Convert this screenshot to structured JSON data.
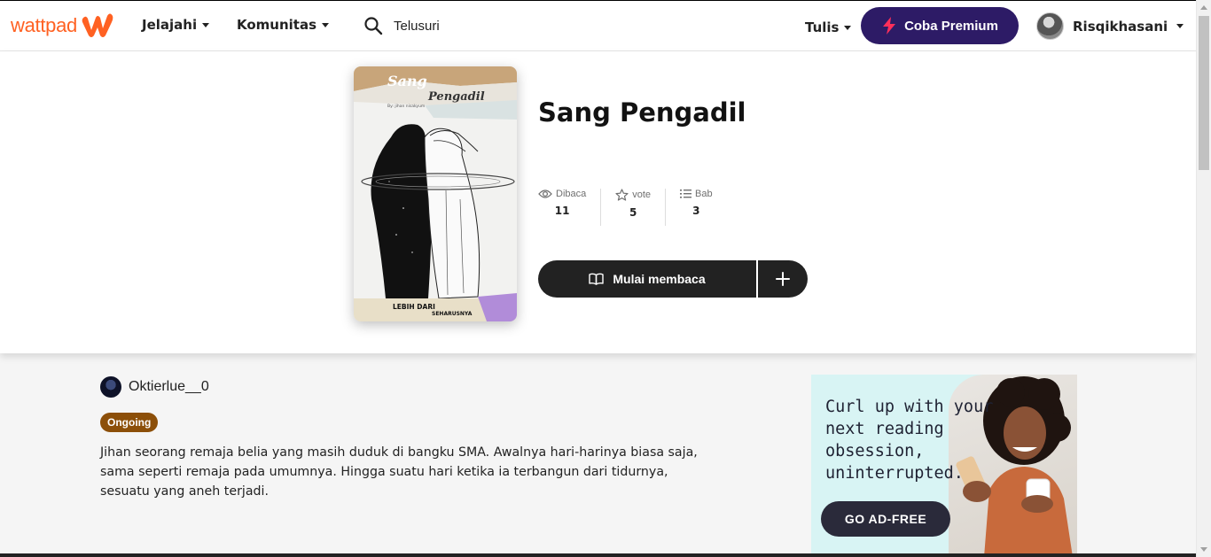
{
  "header": {
    "brand": "wattpad",
    "nav": [
      {
        "label": "Jelajahi"
      },
      {
        "label": "Komunitas"
      }
    ],
    "search_placeholder": "Telusuri",
    "write_label": "Tulis",
    "premium_label": "Coba Premium",
    "username": "Risqikhasani"
  },
  "story": {
    "title": "Sang Pengadil",
    "cover": {
      "title_line1": "Sang",
      "title_line2": "Pengadil",
      "byline": "By: jihan nisakyum",
      "bottom_line1": "LEBIH DARI",
      "bottom_line2": "SEHARUSNYA"
    },
    "stats": {
      "reads_label": "Dibaca",
      "reads_value": "11",
      "votes_label": "vote",
      "votes_value": "5",
      "parts_label": "Bab",
      "parts_value": "3"
    },
    "read_button": "Mulai membaca",
    "author": "Oktierlue__0",
    "status": "Ongoing",
    "description": "Jihan seorang remaja belia yang masih duduk di bangku SMA. Awalnya hari-harinya biasa saja, sama seperti remaja pada umumnya. Hingga suatu hari ketika ia terbangun dari tidurnya, sesuatu yang aneh terjadi."
  },
  "ad": {
    "text": "Curl up with your next reading obsession, uninterrupted.",
    "button": "GO AD-FREE"
  },
  "colors": {
    "brand": "#ff6122",
    "premium": "#2d1b66",
    "status_badge": "#8c4f09",
    "ad_bg": "#d8f4f4"
  }
}
